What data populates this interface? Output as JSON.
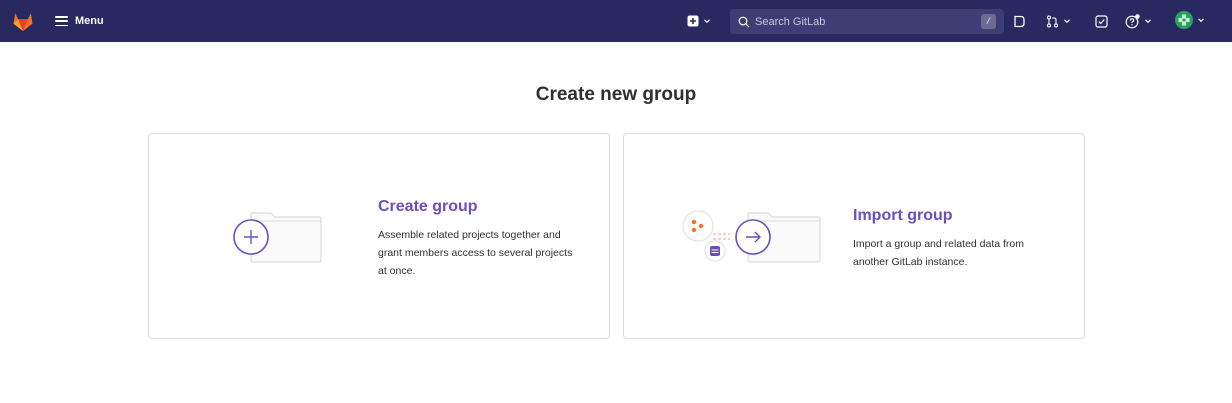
{
  "navbar": {
    "menu_label": "Menu",
    "search_placeholder": "Search GitLab",
    "search_shortcut": "/",
    "icons": [
      "gitlab-logo",
      "hamburger-icon",
      "plus-square-icon",
      "search-icon",
      "issues-icon",
      "merge-request-icon",
      "todo-icon",
      "help-icon",
      "avatar"
    ]
  },
  "page": {
    "title": "Create new group"
  },
  "cards": [
    {
      "title": "Create group",
      "description": "Assemble related projects together and grant members access to several projects at once."
    },
    {
      "title": "Import group",
      "description": "Import a group and related data from another GitLab instance."
    }
  ],
  "colors": {
    "navbar_bg": "#292961",
    "accent_purple": "#6b4fbb",
    "gitlab_orange": "#fc6d26"
  }
}
